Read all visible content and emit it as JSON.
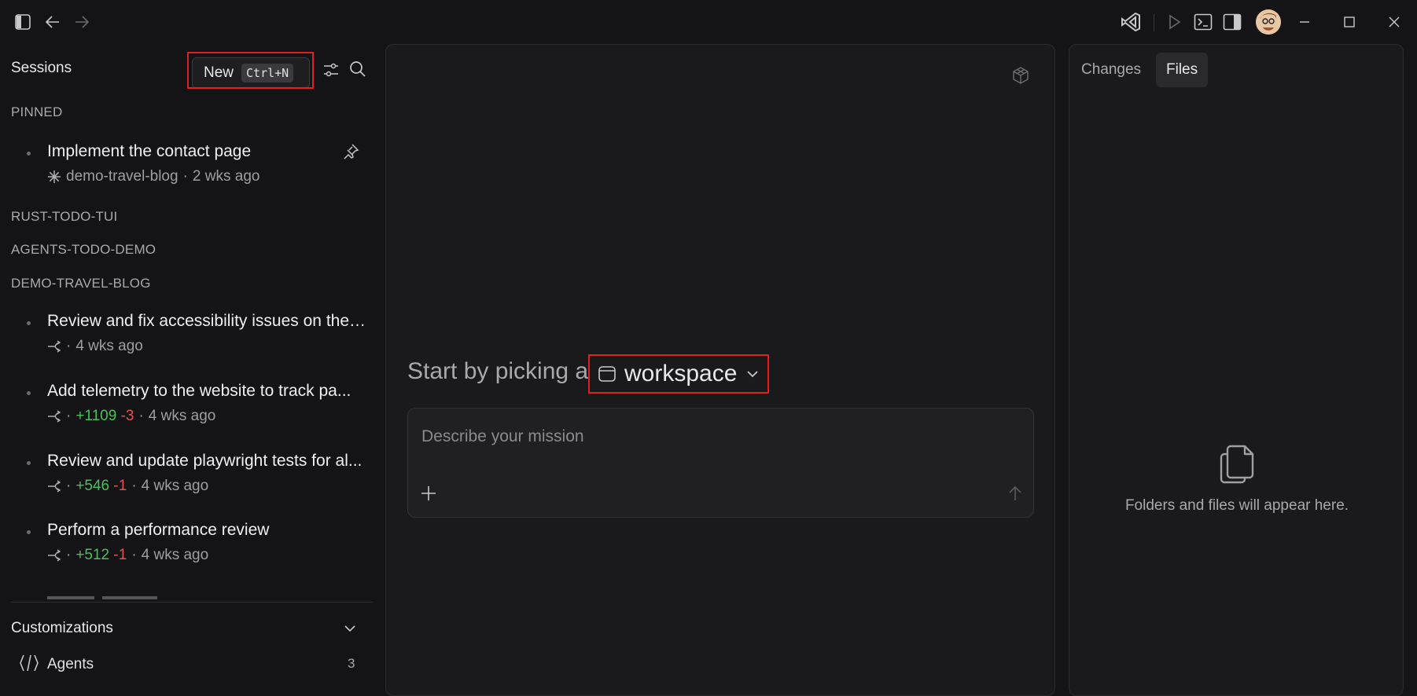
{
  "titlebar": {
    "icons": [
      "toggle-sidebar-icon",
      "back-arrow-icon",
      "forward-arrow-icon",
      "vscode-icon",
      "run-icon",
      "terminal-icon",
      "toggle-panel-icon",
      "avatar",
      "minimize-icon",
      "maximize-icon",
      "close-icon"
    ]
  },
  "sidebar": {
    "title": "Sessions",
    "new_label": "New",
    "new_shortcut": "Ctrl+N",
    "sections": {
      "pinned": "PINNED",
      "rust": "RUST-TODO-TUI",
      "agents": "AGENTS-TODO-DEMO",
      "travel": "DEMO-TRAVEL-BLOG"
    },
    "pinned_session": {
      "title": "Implement the contact page",
      "repo": "demo-travel-blog",
      "sep": "·",
      "time": "2 wks ago"
    },
    "sessions": [
      {
        "title": "Review and fix accessibility issues on the ...",
        "added": "",
        "removed": "",
        "sep": "·",
        "time": "4 wks ago"
      },
      {
        "title": "Add telemetry to the website to track pa...",
        "added": "+1109",
        "removed": "-3",
        "sep": "·",
        "time": "4 wks ago"
      },
      {
        "title": "Review and update playwright tests for al...",
        "added": "+546",
        "removed": "-1",
        "sep": "·",
        "time": "4 wks ago"
      },
      {
        "title": "Perform a performance review",
        "added": "+512",
        "removed": "-1",
        "sep": "·",
        "time": "4 wks ago"
      }
    ],
    "customizations": {
      "title": "Customizations",
      "items": [
        {
          "label": "Agents",
          "count": "3"
        }
      ]
    }
  },
  "center": {
    "prompt_prefix": "Start by picking a",
    "workspace_label": "workspace",
    "mission_placeholder": "Describe your mission"
  },
  "right": {
    "tabs": [
      "Changes",
      "Files"
    ],
    "active_tab": "Files",
    "empty_message": "Folders and files will appear here."
  },
  "colors": {
    "background": "#141416",
    "panel": "#1a1a1c",
    "added": "#4bbf5a",
    "removed": "#e4514e",
    "highlight": "#e02020"
  }
}
